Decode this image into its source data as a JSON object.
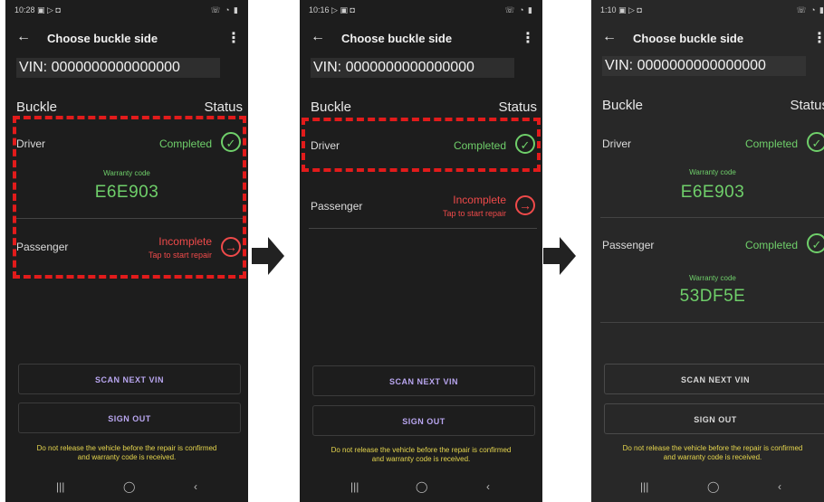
{
  "common": {
    "title": "Choose buckle side",
    "vin": "VIN: 0000000000000000",
    "buckle_header": "Buckle",
    "status_header": "Status",
    "scan_btn": "SCAN NEXT VIN",
    "signout_btn": "SIGN OUT",
    "warning_line1": "Do not release the vehicle before the repair is confirmed",
    "warning_line2": "and warranty code is received.",
    "warranty_label": "Warranty code",
    "tap_to_repair": "Tap to start repair"
  },
  "screens": [
    {
      "time": "10:28",
      "status_icons_left": "▣ ▷ ◘",
      "status_icons_right": "☏ ◔ ▮",
      "driver": {
        "label": "Driver",
        "status": "Completed",
        "code": "E6E903"
      },
      "passenger": {
        "label": "Passenger",
        "status": "Incomplete"
      }
    },
    {
      "time": "10:16",
      "status_icons_left": "▷ ▣ ◘",
      "status_icons_right": "☏ ◔ ▮",
      "driver": {
        "label": "Driver",
        "status": "Completed"
      },
      "passenger": {
        "label": "Passenger",
        "status": "Incomplete"
      }
    },
    {
      "time": "1:10",
      "status_icons_left": "▣ ▷ ◘",
      "status_icons_right": "☏ ◔ ▮",
      "driver": {
        "label": "Driver",
        "status": "Completed",
        "code": "E6E903"
      },
      "passenger": {
        "label": "Passenger",
        "status": "Completed",
        "code": "53DF5E"
      }
    }
  ],
  "colors": {
    "completed": "#6fcf6a",
    "incomplete": "#ef4a4a",
    "highlight": "#e21b1b",
    "warning": "#e6d64e"
  }
}
